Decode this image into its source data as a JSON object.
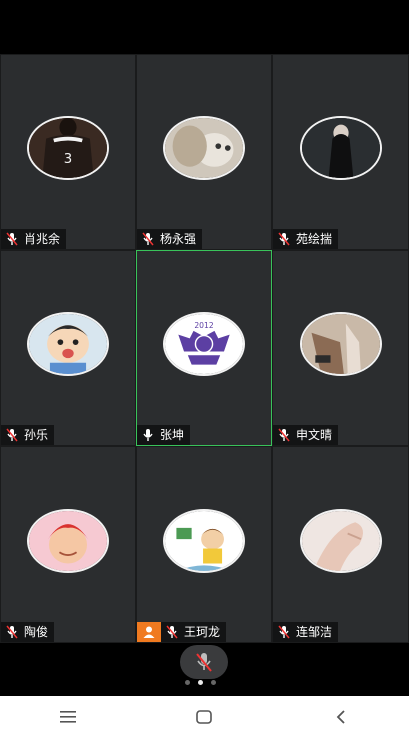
{
  "participants": [
    {
      "name": "肖兆余",
      "avatar": "jersey-avatar"
    },
    {
      "name": "杨永强",
      "avatar": "cat-avatar"
    },
    {
      "name": "苑绘揣",
      "avatar": "portrait-avatar"
    },
    {
      "name": "孙乐",
      "avatar": "cartoon-boy-avatar"
    },
    {
      "name": "张坤",
      "avatar": "logo-avatar",
      "logo_text": "2012"
    },
    {
      "name": "申文晴",
      "avatar": "legs-avatar"
    },
    {
      "name": "陶俊",
      "avatar": "cartoon-girl-avatar"
    },
    {
      "name": "王珂龙",
      "avatar": "cartoon-kid-avatar"
    },
    {
      "name": "连邹洁",
      "avatar": "hand-avatar"
    }
  ],
  "colors": {
    "tile_bg": "#2b2d2f",
    "active_border": "#39c35a",
    "host_badge": "#f07a20"
  },
  "page_indicator": {
    "total": 3,
    "current": 2
  },
  "icons": {
    "mic": "mic-icon",
    "mic_muted": "mic-muted-icon",
    "host": "person-icon",
    "nav_menu": "menu-icon",
    "nav_home": "home-icon",
    "nav_back": "back-icon"
  }
}
